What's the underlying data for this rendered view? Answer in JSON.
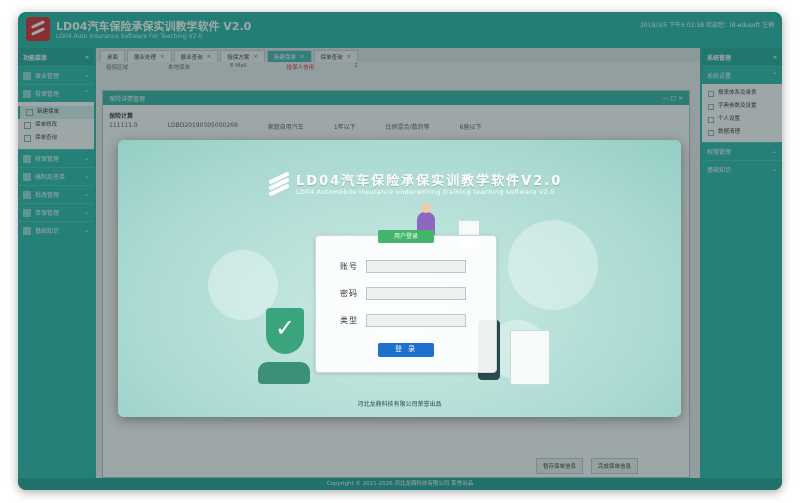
{
  "window": {
    "title": "LD04汽车保险承保实训教学软件 V2.0",
    "subtitle": "LD04 Auto Insurance Software For Teaching V2.0",
    "status": "2019/3/5 下午5:02:58 欢迎您：ld-edusoft   注销"
  },
  "left_sidebar": {
    "header": "功能菜单",
    "items": [
      {
        "label": "展业管理"
      },
      {
        "label": "投保管理"
      }
    ],
    "sub_items": [
      {
        "label": "新建保单",
        "active": true
      },
      {
        "label": "保单修改"
      },
      {
        "label": "保单查询"
      }
    ],
    "items_after": [
      {
        "label": "核保管理"
      },
      {
        "label": "缮制及签单"
      },
      {
        "label": "批改管理"
      },
      {
        "label": "单保管理"
      },
      {
        "label": "基础知识"
      }
    ]
  },
  "right_sidebar": {
    "header": "系统管理",
    "section": "系统设置",
    "sub_items": [
      {
        "label": "报表体系及录表"
      },
      {
        "label": "字典参数及设置"
      },
      {
        "label": "个人设置"
      },
      {
        "label": "数据清理"
      }
    ],
    "items_after": [
      {
        "label": "权限管理"
      },
      {
        "label": "基础知识"
      }
    ]
  },
  "tabs": [
    {
      "label": "桌面"
    },
    {
      "label": "展业处理"
    },
    {
      "label": "展业查询"
    },
    {
      "label": "投保方案"
    },
    {
      "label": "新建保单",
      "active": true
    },
    {
      "label": "保单查询"
    }
  ],
  "background_row": {
    "a": "投保区域",
    "b": "本地保单",
    "c": "E-Mail",
    "d": "投保人信用",
    "e": "2"
  },
  "inner_window": {
    "title": "保险详情管理",
    "section_label": "保险计算",
    "row_values": [
      "111111.0",
      "LDBD20190305000269",
      "家庭自用汽车",
      "1年以下",
      "比例混合/数的等",
      "6座以下"
    ]
  },
  "bottom_buttons": {
    "save": "暂存保单信息",
    "submit": "完成保单信息"
  },
  "footer": "Copyright © 2011-2026 河北龙鼎科技有限公司 荣誉出品",
  "splash": {
    "title": "LD04汽车保险承保实训教学软件V2.0",
    "subtitle": "LD04 Automobile insurance underwriting training teaching software V2.0",
    "login": {
      "header": "用户登录",
      "account_label": "账号",
      "password_label": "密码",
      "type_label": "类型",
      "account_value": "",
      "password_value": "",
      "type_value": "",
      "submit_label": "登 录"
    },
    "footer": "河北龙鼎科技有限公司荣誉出品"
  },
  "colors": {
    "accent": "#1fb5a6",
    "login_button": "#1f6fcc",
    "login_header": "#43b56a"
  }
}
